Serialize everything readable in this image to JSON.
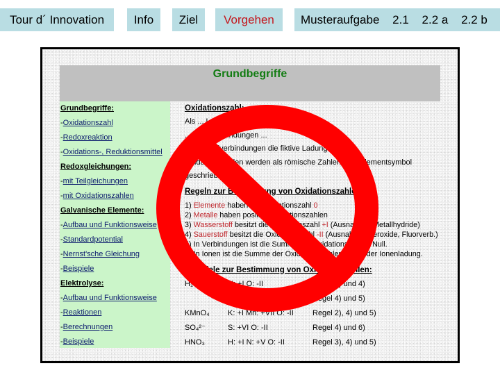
{
  "nav": {
    "tour": "Tour d´ Innovation",
    "info": "Info",
    "ziel": "Ziel",
    "vorgehen": "Vorgehen",
    "musteraufgabe": "Musteraufgabe",
    "t21": "2.1",
    "t22a": "2.2 a",
    "t22b": "2.2 b",
    "active": "Vorgehen",
    "active_color": "#c4161c"
  },
  "slide": {
    "title": "Grundbegriffe",
    "left": [
      {
        "type": "heading",
        "text": "Grundbegriffe:"
      },
      {
        "type": "link",
        "prefix": "-",
        "text": "Oxidationszahl"
      },
      {
        "type": "link",
        "prefix": "-",
        "text": "Redoxreaktion"
      },
      {
        "type": "link",
        "prefix": "-",
        "text": "Oxidations-, Reduktionsmittel"
      },
      {
        "type": "heading",
        "text": "Redoxgleichungen:"
      },
      {
        "type": "link",
        "prefix": "-",
        "text": "mit Teilgleichungen"
      },
      {
        "type": "link",
        "prefix": "-",
        "text": "mit Oxidationszahlen"
      },
      {
        "type": "heading",
        "text": "Galvanische Elemente:"
      },
      {
        "type": "link",
        "prefix": "-",
        "text": "Aufbau und Funktionsweise"
      },
      {
        "type": "link",
        "prefix": "-",
        "text": "Standardpotential"
      },
      {
        "type": "link",
        "prefix": "-",
        "text": "Nernst'sche Gleichung"
      },
      {
        "type": "link",
        "prefix": "-",
        "text": "Beispiele"
      },
      {
        "type": "heading",
        "text": "Elektrolyse:"
      },
      {
        "type": "link",
        "prefix": "-",
        "text": "Aufbau und Funktionsweise"
      },
      {
        "type": "link",
        "prefix": "-",
        "text": "Reaktionen"
      },
      {
        "type": "link",
        "prefix": "-",
        "text": "Berechnungen"
      },
      {
        "type": "link",
        "prefix": "-",
        "text": "Beispiele"
      }
    ],
    "right": {
      "oxz_heading": "Oxidationszahl:",
      "oxz_lines": [
        "Als ... Ladung eines Atoms in",
        "... Ionenverbindungen ...",
        "... Molekülverbindungen die fiktive Ladungszahl.",
        "Oxidationszahlen werden als römische Zahlen zum Elementsymbol",
        "geschrieben."
      ],
      "rules_heading": "Regeln zur Bestimmung von Oxidationszahlen:",
      "rules": [
        {
          "n": "1) ",
          "hl": "Elemente",
          "rest": " haben die Oxidationszahl ",
          "hl2": "0",
          "rest2": ""
        },
        {
          "n": "2) ",
          "hl": "Metalle",
          "rest": " haben positive Oxidationszahlen",
          "hl2": "",
          "rest2": ""
        },
        {
          "n": "3) ",
          "hl": "Wasserstoff",
          "rest": " besitzt die Oxidationszahl ",
          "hl2": "+I",
          "rest2": " (Ausnahme: Metallhydride)"
        },
        {
          "n": "4) ",
          "hl": "Sauerstoff",
          "rest": " besitzt die Oxidationszahl ",
          "hl2": "-II",
          "rest2": " (Ausnahme: Peroxide, Fluorverb.)"
        },
        {
          "n": "5) ",
          "hl": "",
          "rest": "In Verbindungen ist die Summe der Oxidationszahlen Null.",
          "hl2": "",
          "rest2": ""
        },
        {
          "n": "6) ",
          "hl": "",
          "rest": "In Ionen ist die Summe der Oxidationszahlen gleich der Ionenladung.",
          "hl2": "",
          "rest2": ""
        }
      ],
      "examples_heading": "Beispiele zur Bestimmung von Oxidationszahlen:",
      "examples": [
        {
          "formula": "H₂O",
          "ox": "H: +I   O: -II",
          "rule": "Regel 3) und 4)"
        },
        {
          "formula": "",
          "ox": "",
          "rule": "Regel 4) und 5)"
        },
        {
          "formula": "KMnO₄",
          "ox": "K: +I  Mn: +VII  O: -II",
          "rule": "Regel 2), 4) und 5)"
        },
        {
          "formula": "SO₄²⁻",
          "ox": "S: +VI O: -II",
          "rule": "Regel 4) und 6)"
        },
        {
          "formula": "HNO₃",
          "ox": "H: +I   N: +V   O: -II",
          "rule": "Regel 3), 4) und 5)"
        }
      ]
    }
  },
  "overlay": {
    "icon": "prohibition-sign",
    "color": "#ff0000"
  }
}
